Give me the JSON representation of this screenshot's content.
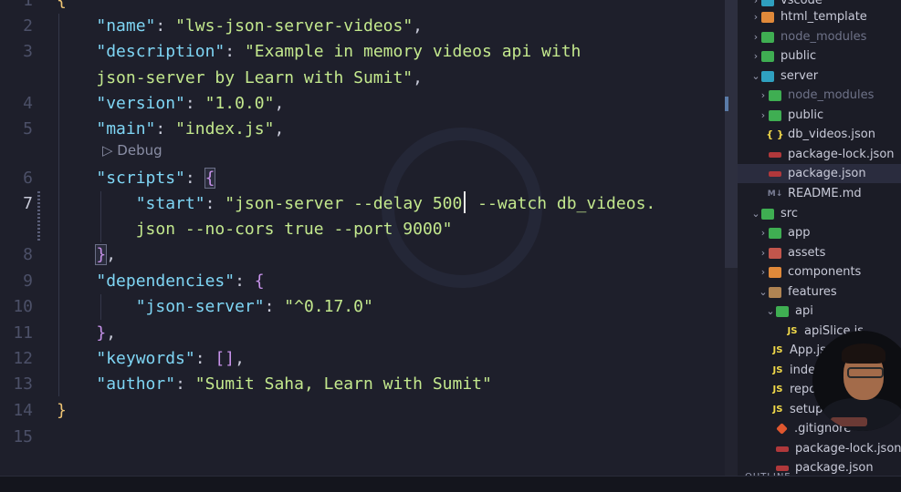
{
  "editor": {
    "line_numbers": [
      "2",
      "3",
      "",
      "4",
      "5",
      "",
      "6",
      "7",
      "",
      "8",
      "9",
      "10",
      "11",
      "12",
      "13",
      "14",
      "15"
    ],
    "codelens": "▷ Debug",
    "lines": {
      "l2": {
        "key": "\"name\"",
        "val": "\"lws-json-server-videos\""
      },
      "l3": {
        "key": "\"description\"",
        "val_a": "\"Example in memory videos api with",
        "val_b": "json-server by Learn with Sumit\""
      },
      "l4": {
        "key": "\"version\"",
        "val": "\"1.0.0\""
      },
      "l5": {
        "key": "\"main\"",
        "val": "\"index.js\""
      },
      "l6": {
        "key": "\"scripts\"",
        "open": "{"
      },
      "l7": {
        "key": "\"start\"",
        "val_a": "\"json-server --delay 500",
        "val_b": " --watch db_videos.",
        "val_c": "json --no-cors true --port 9000\""
      },
      "l8": {
        "close": "}",
        "comma": ","
      },
      "l9": {
        "key": "\"dependencies\"",
        "open": "{"
      },
      "l10": {
        "key": "\"json-server\"",
        "val": "\"^0.17.0\""
      },
      "l11": {
        "close": "}",
        "comma": ","
      },
      "l12": {
        "key": "\"keywords\"",
        "val": "[]"
      },
      "l13": {
        "key": "\"author\"",
        "val": "\"Sumit Saha, Learn with Sumit\""
      },
      "l14": {
        "close": "}"
      },
      "l1": {
        "open": "{"
      }
    }
  },
  "explorer": {
    "items": [
      {
        "label": "vscode",
        "kind": "folder"
      },
      {
        "label": "html_template",
        "kind": "folder"
      },
      {
        "label": "node_modules",
        "kind": "folder"
      },
      {
        "label": "public",
        "kind": "folder"
      },
      {
        "label": "server",
        "kind": "folder-open"
      },
      {
        "label": "node_modules",
        "kind": "folder"
      },
      {
        "label": "public",
        "kind": "folder"
      },
      {
        "label": "db_videos.json",
        "kind": "json"
      },
      {
        "label": "package-lock.json",
        "kind": "npm"
      },
      {
        "label": "package.json",
        "kind": "npm"
      },
      {
        "label": "README.md",
        "kind": "md"
      },
      {
        "label": "src",
        "kind": "folder-open"
      },
      {
        "label": "app",
        "kind": "folder"
      },
      {
        "label": "assets",
        "kind": "folder"
      },
      {
        "label": "components",
        "kind": "folder"
      },
      {
        "label": "features",
        "kind": "folder-open"
      },
      {
        "label": "api",
        "kind": "folder-open"
      },
      {
        "label": "apiSlice.js",
        "kind": "js"
      },
      {
        "label": "App.js",
        "kind": "js"
      },
      {
        "label": "index.js",
        "kind": "js"
      },
      {
        "label": "reportWebVitals.js",
        "kind": "js"
      },
      {
        "label": "setupTests.js",
        "kind": "js"
      },
      {
        "label": ".gitignore",
        "kind": "git"
      },
      {
        "label": "package-lock.json",
        "kind": "npm"
      },
      {
        "label": "package.json",
        "kind": "npm"
      }
    ],
    "json_icon": "{ }",
    "js_icon": "JS",
    "md_icon": "M↓"
  },
  "outline": {
    "label": "OUTLINE"
  },
  "colors": {
    "background": "#1e1f2b",
    "key": "#7fd6f5",
    "string": "#c3e88d",
    "brace": "#f0c674"
  }
}
